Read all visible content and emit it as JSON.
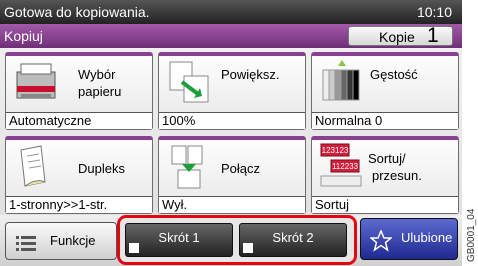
{
  "status_bar": {
    "message": "Gotowa do kopiowania.",
    "time": "10:10"
  },
  "title_bar": {
    "title": "Kopiuj",
    "copies_label": "Kopie",
    "copies_count": "1"
  },
  "tiles": [
    {
      "label_line1": "Wybór",
      "label_line2": "papieru",
      "value": "Automatyczne",
      "icon": "paper-tray-icon"
    },
    {
      "label_line1": "Powiększ.",
      "label_line2": "",
      "value": "100%",
      "icon": "zoom-icon"
    },
    {
      "label_line1": "Gęstość",
      "label_line2": "",
      "value": "Normalna 0",
      "icon": "density-icon"
    },
    {
      "label_line1": "Dupleks",
      "label_line2": "",
      "value": "1-stronny>>1-str.",
      "icon": "duplex-icon"
    },
    {
      "label_line1": "Połącz",
      "label_line2": "",
      "value": "Wył.",
      "icon": "combine-icon"
    },
    {
      "label_line1": "Sortuj/",
      "label_line2": "przesun.",
      "value": "Sortuj",
      "icon": "collate-icon",
      "badge1": "123123",
      "badge2": "112233"
    }
  ],
  "bottom_bar": {
    "functions_label": "Funkcje",
    "shortcut1_label": "Skrót 1",
    "shortcut2_label": "Skrót 2",
    "favorites_label": "Ulubione"
  },
  "doc_code": "GB0001_04",
  "colors": {
    "accent": "#8b3f92",
    "highlight": "#e30613",
    "favorites": "#1f2a8f"
  }
}
